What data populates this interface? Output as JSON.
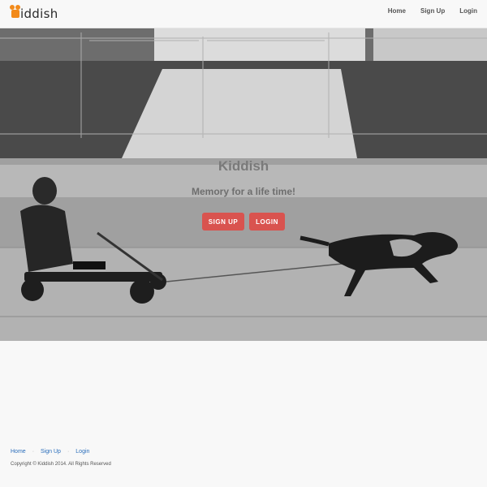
{
  "brand": {
    "logo_text": "iddish",
    "color": "#f28a1a"
  },
  "nav": {
    "items": [
      {
        "label": "Home"
      },
      {
        "label": "Sign Up"
      },
      {
        "label": "Login"
      }
    ]
  },
  "hero": {
    "title": "Kiddish",
    "subtitle": "Memory for a life time!",
    "signup_label": "SIGN UP",
    "login_label": "LOGIN",
    "button_color": "#d9534f"
  },
  "footer": {
    "links": [
      {
        "label": "Home"
      },
      {
        "label": "Sign Up"
      },
      {
        "label": "Login"
      }
    ],
    "copyright": "Copyright © Kiddish 2014. All Rights Reserved"
  }
}
